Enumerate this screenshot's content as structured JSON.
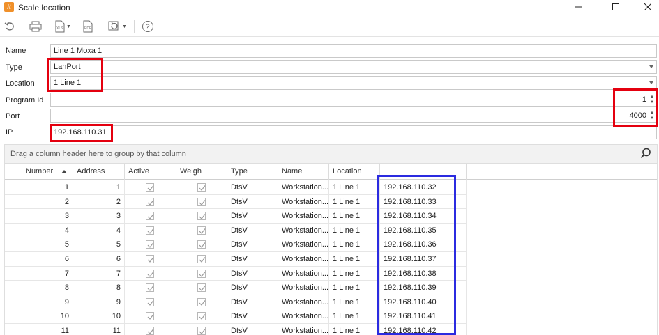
{
  "window": {
    "title": "Scale location",
    "logo": "it"
  },
  "toolbar": {
    "icons": [
      "undo-icon",
      "print-icon",
      "xls-export-icon",
      "pdf-export-icon",
      "refresh-dropdown-icon",
      "help-icon"
    ],
    "xls_label": "XLS",
    "pdf_label": "PDF"
  },
  "form": {
    "name_label": "Name",
    "name_value": "Line 1 Moxa 1",
    "type_label": "Type",
    "type_value": "LanPort",
    "location_label": "Location",
    "location_value": "1 Line 1",
    "program_id_label": "Program Id",
    "program_id_value": "1",
    "port_label": "Port",
    "port_value": "4000",
    "ip_label": "IP",
    "ip_value": "192.168.110.31"
  },
  "grid": {
    "group_hint": "Drag a column header here to group by that column",
    "columns": [
      "Number",
      "Address",
      "Active",
      "Weigh",
      "Type",
      "Name",
      "Location",
      ""
    ],
    "sort_column": "Number",
    "sort_direction": "ascending",
    "rows": [
      {
        "number": "1",
        "address": "1",
        "active": true,
        "weigh": true,
        "type": "DtsV",
        "name": "Workstation...",
        "location": "1 Line 1",
        "ip": "192.168.110.32"
      },
      {
        "number": "2",
        "address": "2",
        "active": true,
        "weigh": true,
        "type": "DtsV",
        "name": "Workstation...",
        "location": "1 Line 1",
        "ip": "192.168.110.33"
      },
      {
        "number": "3",
        "address": "3",
        "active": true,
        "weigh": true,
        "type": "DtsV",
        "name": "Workstation...",
        "location": "1 Line 1",
        "ip": "192.168.110.34"
      },
      {
        "number": "4",
        "address": "4",
        "active": true,
        "weigh": true,
        "type": "DtsV",
        "name": "Workstation...",
        "location": "1 Line 1",
        "ip": "192.168.110.35"
      },
      {
        "number": "5",
        "address": "5",
        "active": true,
        "weigh": true,
        "type": "DtsV",
        "name": "Workstation...",
        "location": "1 Line 1",
        "ip": "192.168.110.36"
      },
      {
        "number": "6",
        "address": "6",
        "active": true,
        "weigh": true,
        "type": "DtsV",
        "name": "Workstation...",
        "location": "1 Line 1",
        "ip": "192.168.110.37"
      },
      {
        "number": "7",
        "address": "7",
        "active": true,
        "weigh": true,
        "type": "DtsV",
        "name": "Workstation...",
        "location": "1 Line 1",
        "ip": "192.168.110.38"
      },
      {
        "number": "8",
        "address": "8",
        "active": true,
        "weigh": true,
        "type": "DtsV",
        "name": "Workstation...",
        "location": "1 Line 1",
        "ip": "192.168.110.39"
      },
      {
        "number": "9",
        "address": "9",
        "active": true,
        "weigh": true,
        "type": "DtsV",
        "name": "Workstation...",
        "location": "1 Line 1",
        "ip": "192.168.110.40"
      },
      {
        "number": "10",
        "address": "10",
        "active": true,
        "weigh": true,
        "type": "DtsV",
        "name": "Workstation...",
        "location": "1 Line 1",
        "ip": "192.168.110.41"
      },
      {
        "number": "11",
        "address": "11",
        "active": true,
        "weigh": true,
        "type": "DtsV",
        "name": "Workstation...",
        "location": "1 Line 1",
        "ip": "192.168.110.42"
      }
    ]
  },
  "annotations": {
    "red": "#e4000f",
    "blue": "#2b2be0"
  }
}
